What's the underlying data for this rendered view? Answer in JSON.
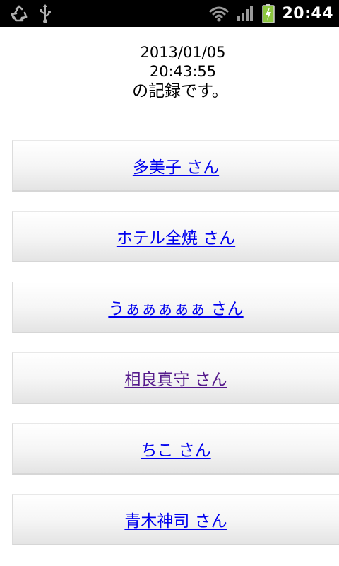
{
  "status_bar": {
    "icons_left": [
      "recycle-icon",
      "usb-icon"
    ],
    "icons_right": [
      "wifi-icon",
      "signal-icon",
      "battery-charging-icon"
    ],
    "time": "20:44"
  },
  "record": {
    "date": "2013/01/05",
    "time": "20:43:55",
    "suffix": "の記録です。"
  },
  "users": [
    {
      "label": "多美子 さん",
      "visited": false
    },
    {
      "label": "ホテル全焼 さん",
      "visited": false
    },
    {
      "label": "うぁぁぁぁぁ さん",
      "visited": false
    },
    {
      "label": "相良真守 さん",
      "visited": true
    },
    {
      "label": "ちこ さん",
      "visited": false
    },
    {
      "label": "青木神司 さん",
      "visited": false
    }
  ],
  "colors": {
    "link": "#0000ee",
    "visited_link": "#551a8b",
    "battery": "#8cc63f"
  }
}
